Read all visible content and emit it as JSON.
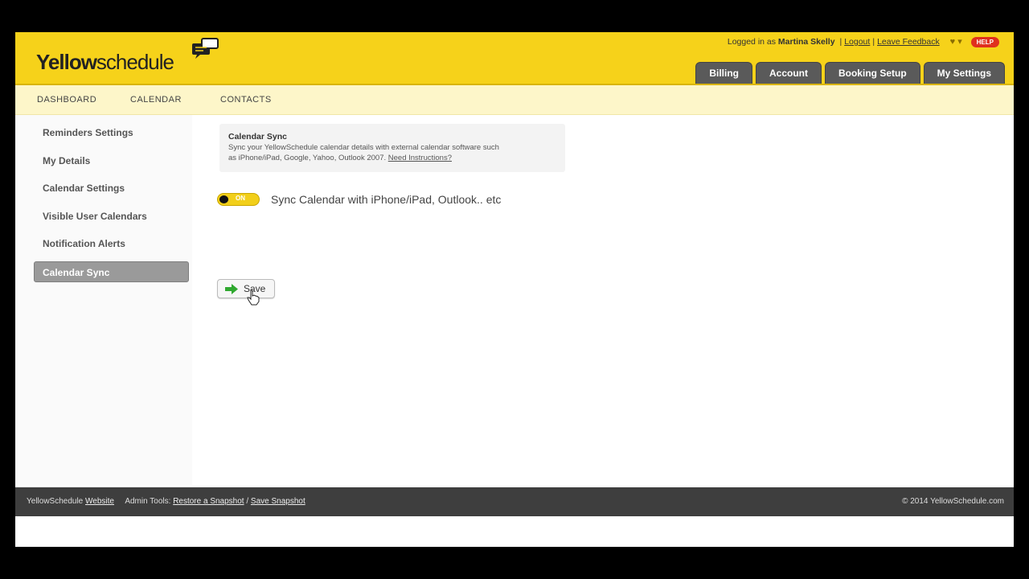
{
  "header": {
    "logo_bold": "Yellow",
    "logo_light": "schedule",
    "logged_in_prefix": "Logged in as",
    "user_name": "Martina Skelly",
    "logout": "Logout",
    "separator": "|",
    "feedback": "Leave Feedback",
    "help": "HELP",
    "tabs": [
      {
        "label": "Billing"
      },
      {
        "label": "Account"
      },
      {
        "label": "Booking Setup"
      },
      {
        "label": "My Settings"
      }
    ]
  },
  "nav": {
    "items": [
      {
        "label": "DASHBOARD"
      },
      {
        "label": "CALENDAR"
      },
      {
        "label": "CONTACTS"
      }
    ]
  },
  "sidebar": {
    "items": [
      {
        "label": "Reminders Settings"
      },
      {
        "label": "My Details"
      },
      {
        "label": "Calendar Settings"
      },
      {
        "label": "Visible User Calendars"
      },
      {
        "label": "Notification Alerts"
      },
      {
        "label": "Calendar Sync",
        "active": true
      }
    ]
  },
  "main": {
    "info_title": "Calendar Sync",
    "info_text_1": "Sync your YellowSchedule calendar details with external calendar software such",
    "info_text_2": "as iPhone/iPad, Google, Yahoo, Outlook 2007.",
    "info_link": "Need Instructions?",
    "toggle_text": "ON",
    "sync_label": "Sync Calendar with iPhone/iPad, Outlook.. etc",
    "save_label": "Save"
  },
  "footer": {
    "site_prefix": "YellowSchedule",
    "site_link": "Website",
    "admin_prefix": "Admin Tools:",
    "restore_link": "Restore a Snapshot",
    "slash": "/",
    "save_link": "Save Snapshot",
    "copyright": "© 2014  YellowSchedule.com"
  },
  "colors": {
    "brand_yellow": "#f6d21a",
    "tab_gray": "#5a5a5a",
    "help_red": "#e0301e"
  }
}
